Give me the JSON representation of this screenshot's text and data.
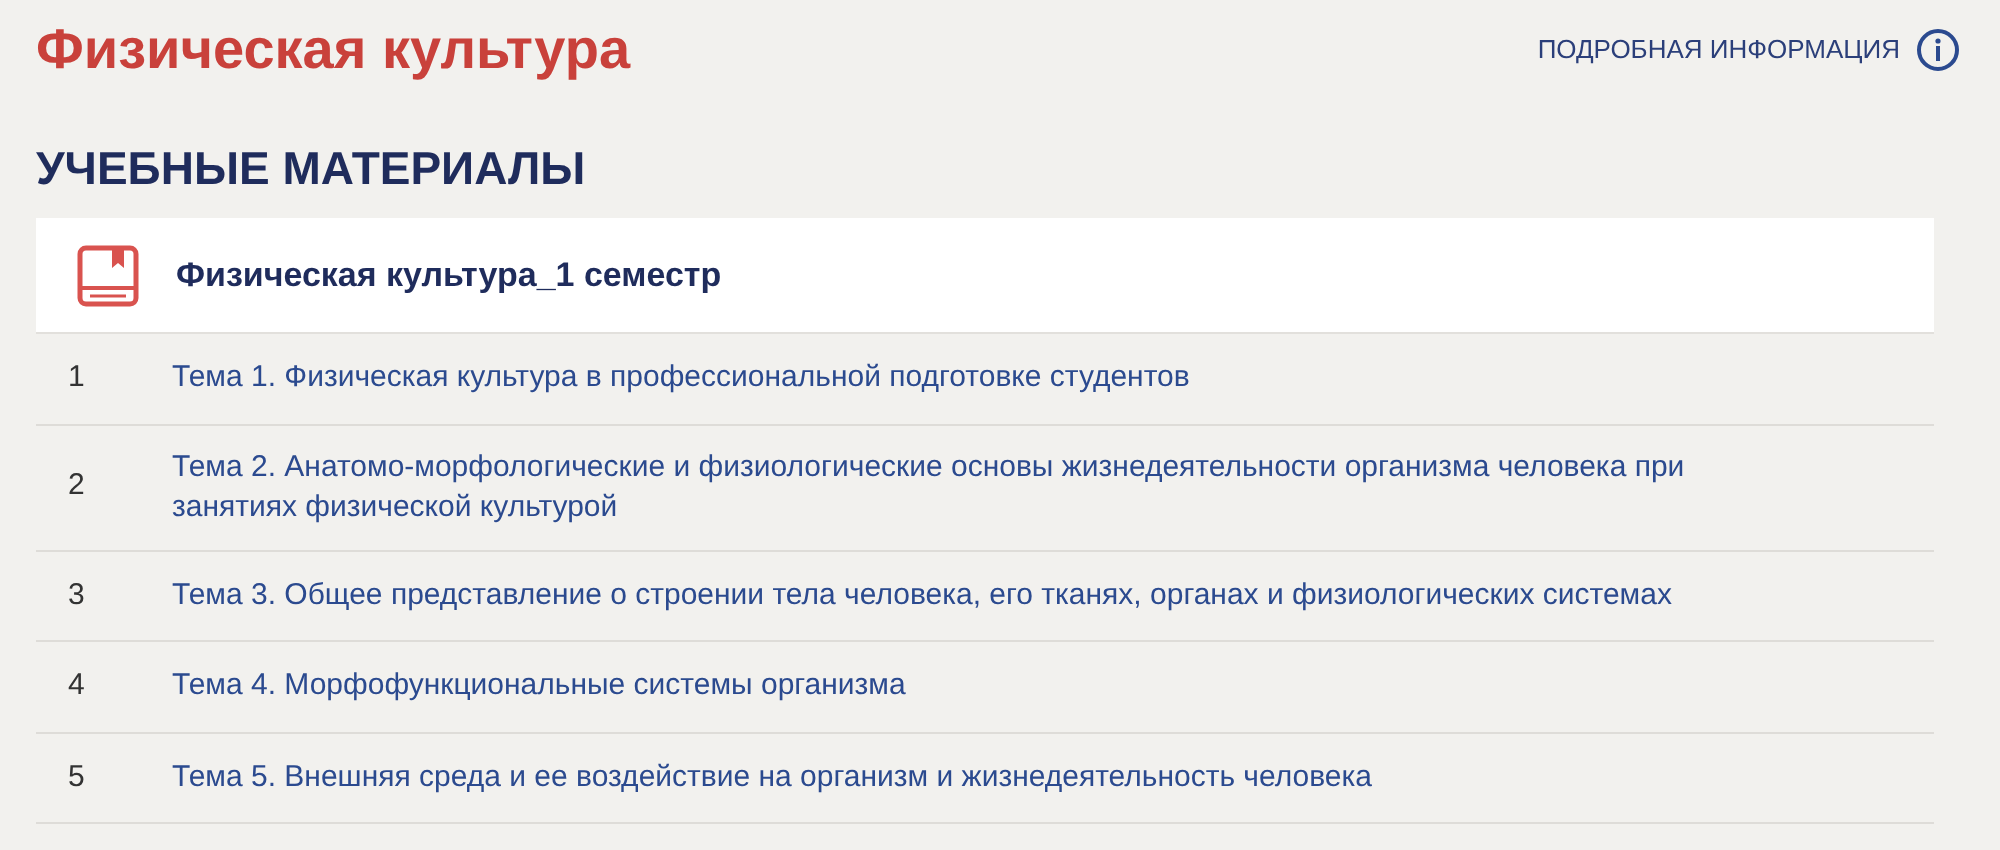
{
  "title": "Физическая культура",
  "info_link": "ПОДРОБНАЯ ИНФОРМАЦИЯ",
  "section_title": "УЧЕБНЫЕ МАТЕРИАЛЫ",
  "course": {
    "title": "Физическая культура_1 семестр",
    "topics": [
      {
        "number": "1",
        "title": "Тема 1. Физическая культура в профессиональной подготовке студентов"
      },
      {
        "number": "2",
        "title": "Тема 2. Анатомо-морфологические и физиологические основы жизнедеятельности организма человека при занятиях физической культурой"
      },
      {
        "number": "3",
        "title": "Тема 3. Общее представление о строении тела человека, его тканях, органах и физиологических системах"
      },
      {
        "number": "4",
        "title": "Тема 4. Морфофункциональные системы организма"
      },
      {
        "number": "5",
        "title": "Тема 5. Внешняя среда и ее воздействие на организм и жизнедеятельность человека"
      }
    ]
  }
}
